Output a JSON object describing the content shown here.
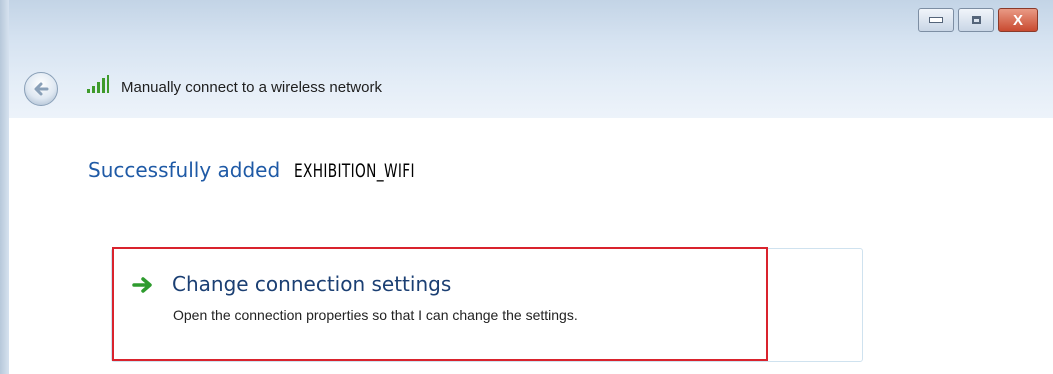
{
  "window": {
    "title": "Manually connect to a wireless network",
    "controls": {
      "minimize_icon": "minimize-icon",
      "maximize_icon": "maximize-icon",
      "close_label": "X"
    }
  },
  "nav": {
    "back_icon": "back-arrow-icon",
    "wifi_icon": "wifi-signal-icon"
  },
  "main": {
    "success_prefix": "Successfully added",
    "network_name": "EXHIBITION_WIFI",
    "option": {
      "icon": "green-arrow-icon",
      "title": "Change connection settings",
      "description": "Open the connection properties so that I can change the settings."
    }
  },
  "colors": {
    "titlebar": "#d6e3f1",
    "heading_blue": "#1f5aa6",
    "option_title": "#1b3f73",
    "highlight_red": "#d9232d",
    "arrow_green": "#2e9b2e",
    "close_red": "#c94a30"
  }
}
